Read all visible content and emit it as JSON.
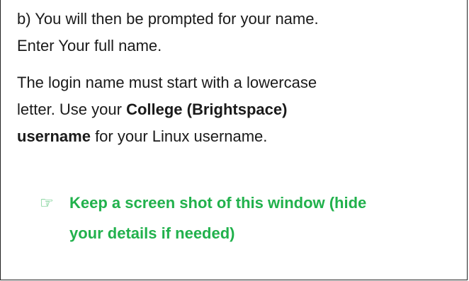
{
  "step": {
    "line1": "b) You will then be prompted for your name.",
    "line2": "Enter Your full name."
  },
  "login_info": {
    "line1": "The login name must start with a lowercase",
    "line2_pre": "letter.  Use your ",
    "line2_bold": "College (Brightspace)",
    "line3_bold": "username",
    "line3_post": " for your Linux username."
  },
  "note": {
    "icon": "pointing-hand-icon",
    "icon_glyph": "☞",
    "line1": "Keep a screen shot of this window (hide",
    "line2": "your details if needed)",
    "color": "#21b14c"
  }
}
